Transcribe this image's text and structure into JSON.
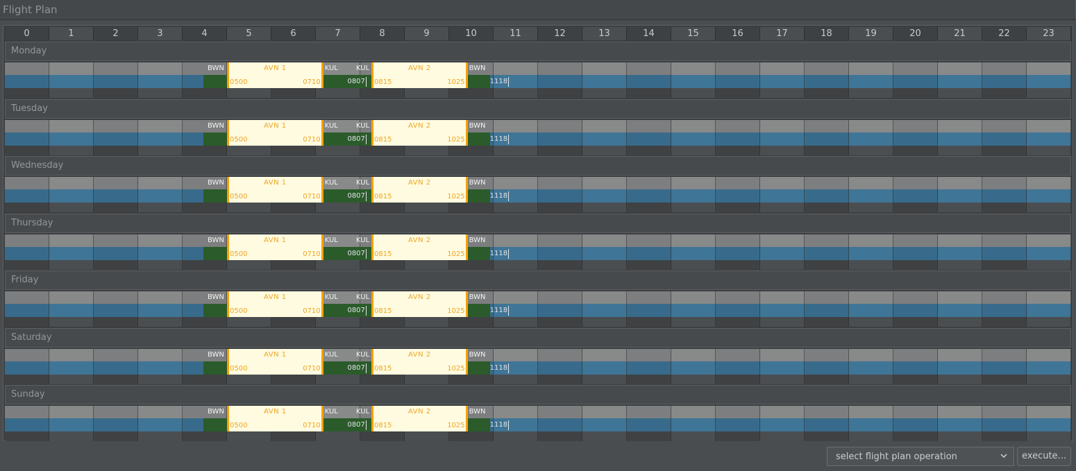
{
  "window": {
    "title": "Flight Plan"
  },
  "hours": [
    "0",
    "1",
    "2",
    "3",
    "4",
    "5",
    "6",
    "7",
    "8",
    "9",
    "10",
    "11",
    "12",
    "13",
    "14",
    "15",
    "16",
    "17",
    "18",
    "19",
    "20",
    "21",
    "22",
    "23"
  ],
  "days": [
    {
      "name": "Monday",
      "segments": {
        "origin_airport": "BWN",
        "flight1": {
          "name": "AVN  1",
          "dep": "0500",
          "arr": "0710",
          "from": "BWN",
          "to": "KUL"
        },
        "kul_arrival_label": "KUL",
        "kul_departure_label": "KUL",
        "ground_marker": "0807",
        "flight2": {
          "name": "AVN  2",
          "dep": "0815",
          "arr": "1025",
          "from": "KUL",
          "to": "BWN"
        },
        "return_airport": "BWN",
        "end_marker": "1118"
      }
    },
    {
      "name": "Tuesday",
      "segments": {
        "origin_airport": "BWN",
        "flight1": {
          "name": "AVN  1",
          "dep": "0500",
          "arr": "0710",
          "from": "BWN",
          "to": "KUL"
        },
        "kul_arrival_label": "KUL",
        "kul_departure_label": "KUL",
        "ground_marker": "0807",
        "flight2": {
          "name": "AVN  2",
          "dep": "0815",
          "arr": "1025",
          "from": "KUL",
          "to": "BWN"
        },
        "return_airport": "BWN",
        "end_marker": "1118"
      }
    },
    {
      "name": "Wednesday",
      "segments": {
        "origin_airport": "BWN",
        "flight1": {
          "name": "AVN  1",
          "dep": "0500",
          "arr": "0710",
          "from": "BWN",
          "to": "KUL"
        },
        "kul_arrival_label": "KUL",
        "kul_departure_label": "KUL",
        "ground_marker": "0807",
        "flight2": {
          "name": "AVN  2",
          "dep": "0815",
          "arr": "1025",
          "from": "KUL",
          "to": "BWN"
        },
        "return_airport": "BWN",
        "end_marker": "1118"
      }
    },
    {
      "name": "Thursday",
      "segments": {
        "origin_airport": "BWN",
        "flight1": {
          "name": "AVN  1",
          "dep": "0500",
          "arr": "0710",
          "from": "BWN",
          "to": "KUL"
        },
        "kul_arrival_label": "KUL",
        "kul_departure_label": "KUL",
        "ground_marker": "0807",
        "flight2": {
          "name": "AVN  2",
          "dep": "0815",
          "arr": "1025",
          "from": "KUL",
          "to": "BWN"
        },
        "return_airport": "BWN",
        "end_marker": "1118"
      }
    },
    {
      "name": "Friday",
      "segments": {
        "origin_airport": "BWN",
        "flight1": {
          "name": "AVN  1",
          "dep": "0500",
          "arr": "0710",
          "from": "BWN",
          "to": "KUL"
        },
        "kul_arrival_label": "KUL",
        "kul_departure_label": "KUL",
        "ground_marker": "0807",
        "flight2": {
          "name": "AVN  2",
          "dep": "0815",
          "arr": "1025",
          "from": "KUL",
          "to": "BWN"
        },
        "return_airport": "BWN",
        "end_marker": "1118"
      }
    },
    {
      "name": "Saturday",
      "segments": {
        "origin_airport": "BWN",
        "flight1": {
          "name": "AVN  1",
          "dep": "0500",
          "arr": "0710",
          "from": "BWN",
          "to": "KUL"
        },
        "kul_arrival_label": "KUL",
        "kul_departure_label": "KUL",
        "ground_marker": "0807",
        "flight2": {
          "name": "AVN  2",
          "dep": "0815",
          "arr": "1025",
          "from": "KUL",
          "to": "BWN"
        },
        "return_airport": "BWN",
        "end_marker": "1118"
      }
    },
    {
      "name": "Sunday",
      "segments": {
        "origin_airport": "BWN",
        "flight1": {
          "name": "AVN  1",
          "dep": "0500",
          "arr": "0710",
          "from": "BWN",
          "to": "KUL"
        },
        "kul_arrival_label": "KUL",
        "kul_departure_label": "KUL",
        "ground_marker": "0807",
        "flight2": {
          "name": "AVN  2",
          "dep": "0815",
          "arr": "1025",
          "from": "KUL",
          "to": "BWN"
        },
        "return_airport": "BWN",
        "end_marker": "1118"
      }
    }
  ],
  "footer": {
    "operation_select": {
      "selected": "select flight plan operation",
      "icon": "chevron-down-icon"
    },
    "execute_label": "execute..."
  },
  "colors": {
    "flight_block": "#fefbe0",
    "flight_border": "#f5a20a",
    "flight_text": "#f0a525",
    "ground_time": "#2b5b2b",
    "available_lane": "#3f7596",
    "airport_lane": "#888989"
  }
}
